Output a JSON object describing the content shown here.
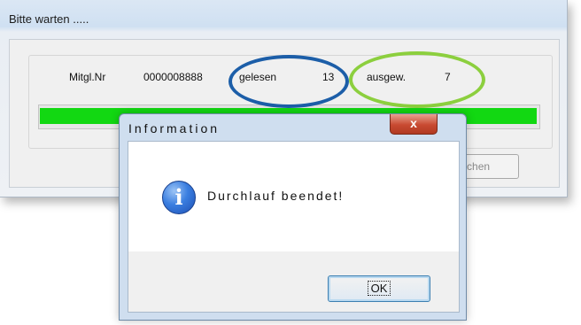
{
  "background_window": {
    "title": "Bitte warten .....",
    "mitglnr_label": "Mitgl.Nr",
    "mitglnr_value": "0000008888",
    "gelesen_label": "gelesen",
    "gelesen_value": "13",
    "ausgew_label": "ausgew.",
    "ausgew_value": "7",
    "progress_fraction": 1.0,
    "progress_color": "#12d812",
    "cancel_button_label": "Abbrechen"
  },
  "annotations": {
    "blue_circle_color": "#1c5ea8",
    "green_circle_color": "#8ccf3e"
  },
  "dialog": {
    "title": "Information",
    "close_glyph": "x",
    "icon": "info-icon",
    "message": "Durchlauf beendet!",
    "ok_label": "OK"
  }
}
